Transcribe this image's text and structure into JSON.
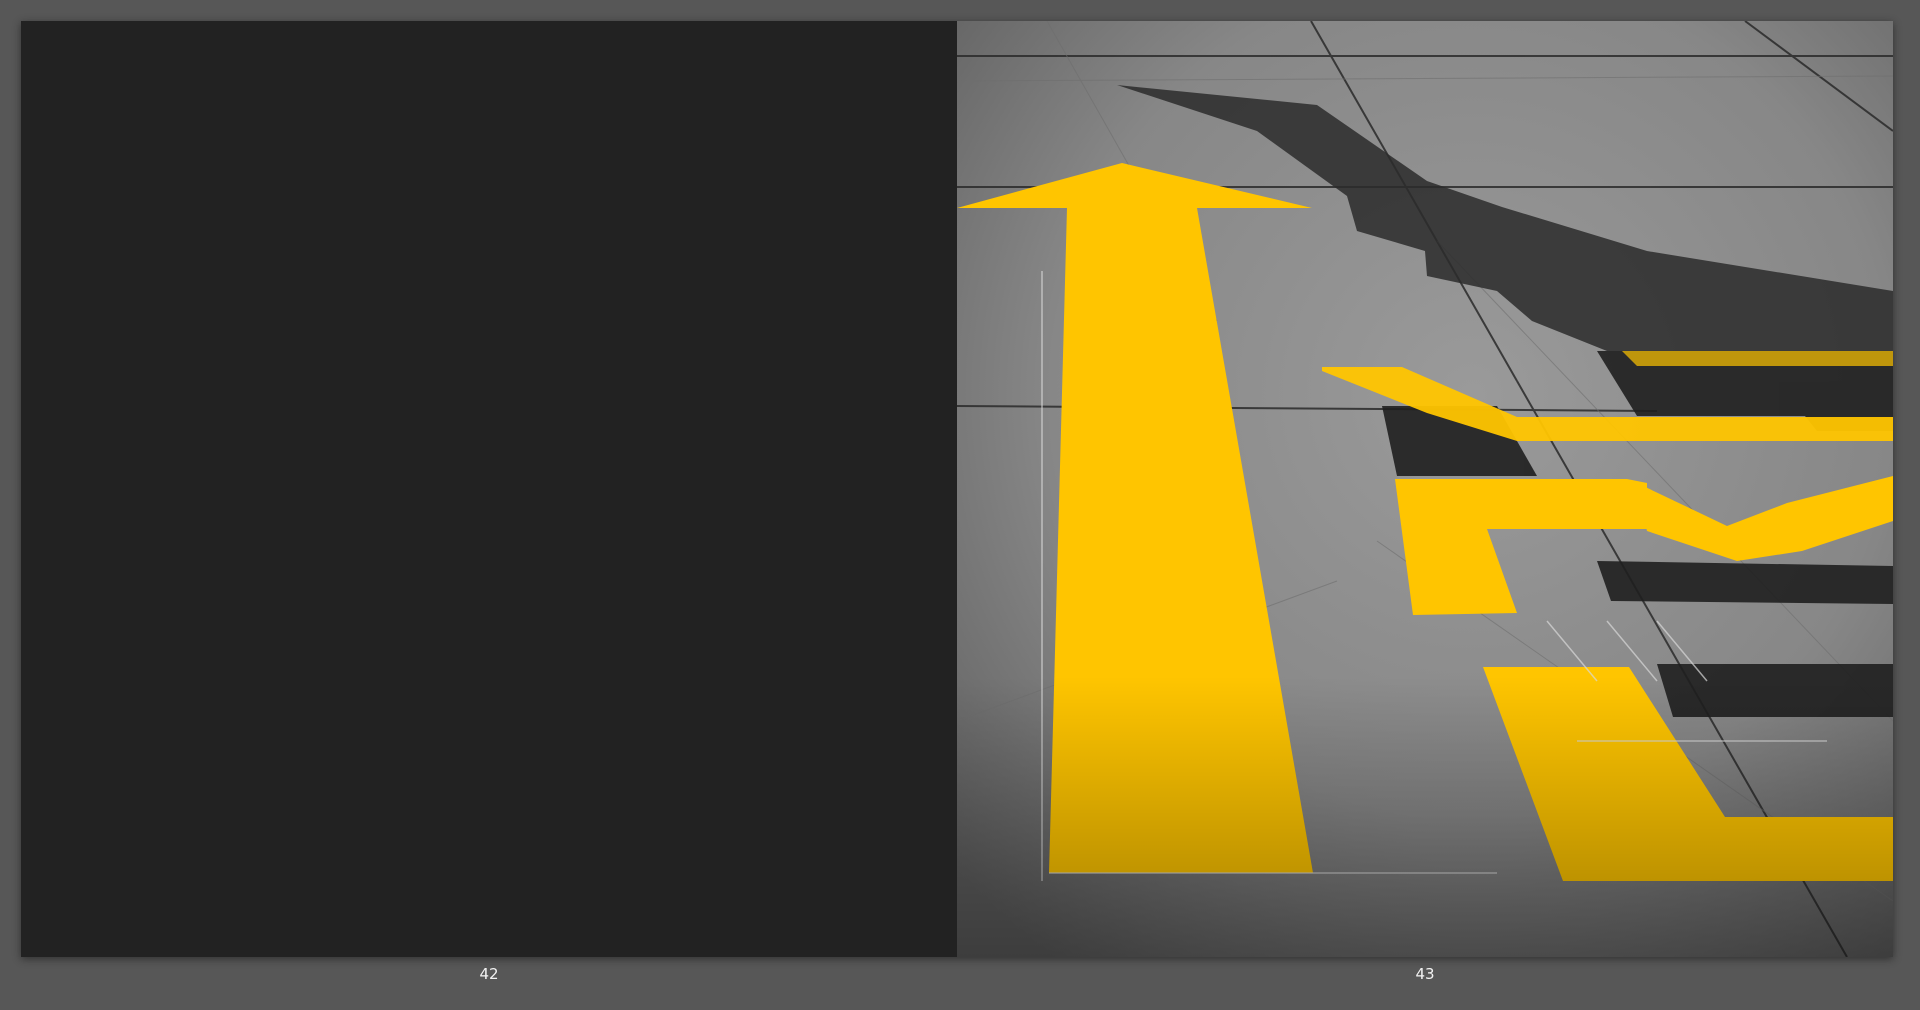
{
  "spread": {
    "left_page": {
      "number": "42",
      "fill": "#222222"
    },
    "right_page": {
      "number": "43",
      "photo": "yellow-arrow-on-concrete",
      "colors": {
        "concrete": "#8a8a8a",
        "paint_yellow": "#ffc500",
        "shadow": "#2b2b2b"
      }
    }
  },
  "viewer": {
    "background": "#575757"
  }
}
